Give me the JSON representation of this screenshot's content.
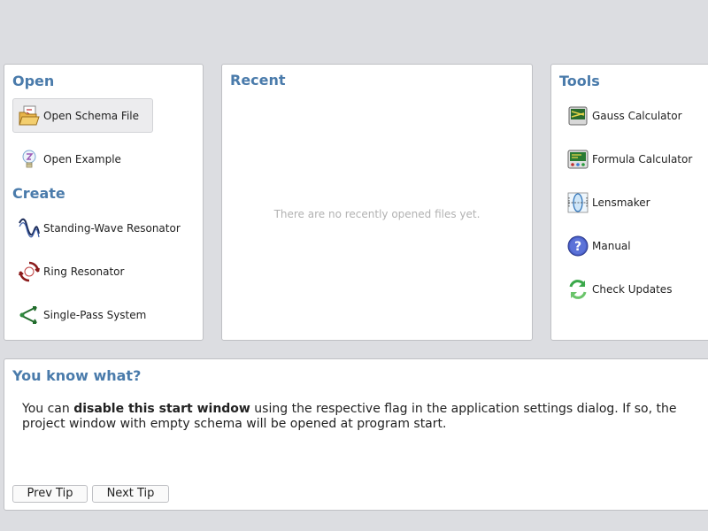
{
  "open": {
    "title": "Open",
    "items": [
      {
        "label": "Open Schema File",
        "icon": "open-folder-icon"
      },
      {
        "label": "Open Example",
        "icon": "lightbulb-icon"
      }
    ]
  },
  "create": {
    "title": "Create",
    "items": [
      {
        "label": "Standing-Wave Resonator",
        "icon": "wave-icon"
      },
      {
        "label": "Ring Resonator",
        "icon": "ring-icon"
      },
      {
        "label": "Single-Pass System",
        "icon": "single-pass-icon"
      }
    ]
  },
  "recent": {
    "title": "Recent",
    "empty_text": "There are no recently opened files yet."
  },
  "tools": {
    "title": "Tools",
    "items": [
      {
        "label": "Gauss Calculator",
        "icon": "gauss-calculator-icon"
      },
      {
        "label": "Formula Calculator",
        "icon": "formula-calculator-icon"
      },
      {
        "label": "Lensmaker",
        "icon": "lens-icon"
      },
      {
        "label": "Manual",
        "icon": "help-icon"
      },
      {
        "label": "Check Updates",
        "icon": "refresh-icon"
      }
    ]
  },
  "tip": {
    "title": "You know what?",
    "text_before": "You can ",
    "text_bold": "disable this start window",
    "text_after": " using the respective flag in the application settings dialog. If so, the project window with empty schema will be opened at program start.",
    "prev_label": "Prev Tip",
    "next_label": "Next Tip"
  },
  "colors": {
    "heading": "#4a7bab",
    "background": "#dcdde1",
    "panel": "#ffffff",
    "muted_text": "#b2b2b2"
  }
}
